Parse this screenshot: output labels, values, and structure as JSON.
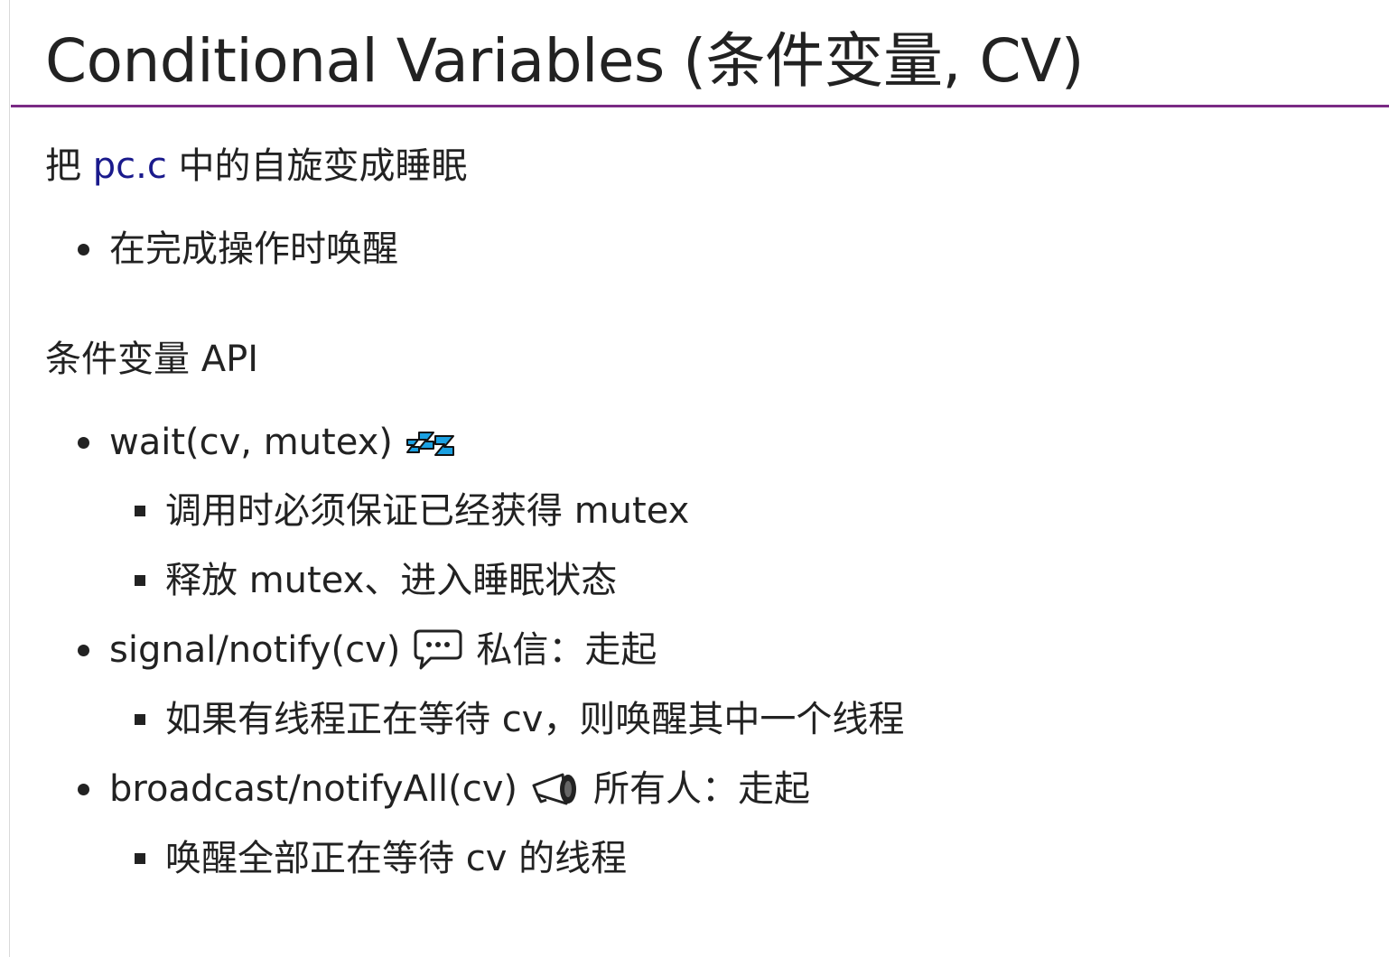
{
  "title": "Conditional Variables (条件变量, CV)",
  "intro": {
    "prefix": "把 ",
    "link": "pc.c",
    "suffix": " 中的自旋变成睡眠"
  },
  "intro_bullets": [
    "在完成操作时唤醒"
  ],
  "api_heading": "条件变量 API",
  "api": [
    {
      "label": "wait(cv, mutex)",
      "icon": "zzz-icon",
      "extra": "",
      "details": [
        "调用时必须保证已经获得 mutex",
        "释放 mutex、进入睡眠状态"
      ]
    },
    {
      "label": "signal/notify(cv)",
      "icon": "speech-bubble-icon",
      "extra": "私信：走起",
      "details": [
        "如果有线程正在等待 cv，则唤醒其中一个线程"
      ]
    },
    {
      "label": "broadcast/notifyAll(cv)",
      "icon": "megaphone-icon",
      "extra": "所有人：走起",
      "details": [
        "唤醒全部正在等待 cv 的线程"
      ]
    }
  ],
  "colors": {
    "title_rule": "#7a2a84",
    "link": "#1a1a8c",
    "text": "#222222",
    "zzz_fill": "#1ba1e2"
  }
}
